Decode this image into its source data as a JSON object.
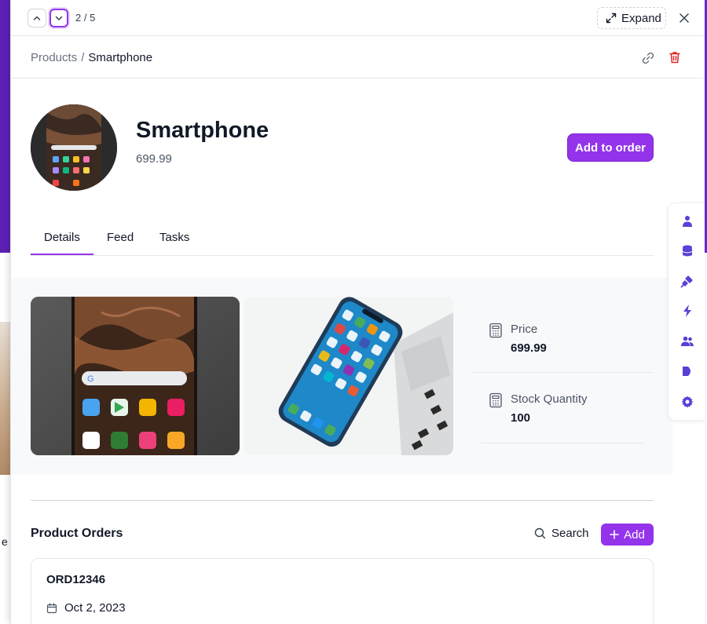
{
  "topbar": {
    "counter": "2 / 5",
    "expand_label": "Expand"
  },
  "breadcrumb": {
    "parent": "Products",
    "separator": "/",
    "current": "Smartphone"
  },
  "product": {
    "name": "Smartphone",
    "price_subtitle": "699.99",
    "add_to_order_label": "Add to order"
  },
  "tabs": [
    {
      "label": "Details",
      "active": true
    },
    {
      "label": "Feed",
      "active": false
    },
    {
      "label": "Tasks",
      "active": false
    }
  ],
  "stats": [
    {
      "label": "Price",
      "value": "699.99",
      "icon": "calculator-icon"
    },
    {
      "label": "Stock Quantity",
      "value": "100",
      "icon": "calculator-icon"
    }
  ],
  "orders_section": {
    "title": "Product Orders",
    "search_label": "Search",
    "add_label": "Add"
  },
  "orders": [
    {
      "id": "ORD12346",
      "date": "Oct 2, 2023"
    }
  ],
  "side_toolbar": [
    "person-icon",
    "database-icon",
    "plug-icon",
    "bolt-icon",
    "users-icon",
    "tag-icon",
    "gear-icon"
  ],
  "background": {
    "partial_text": "e fo"
  },
  "colors": {
    "accent": "#9333ea",
    "toolbar_icon": "#5b3fd6",
    "delete": "#dc2626"
  }
}
